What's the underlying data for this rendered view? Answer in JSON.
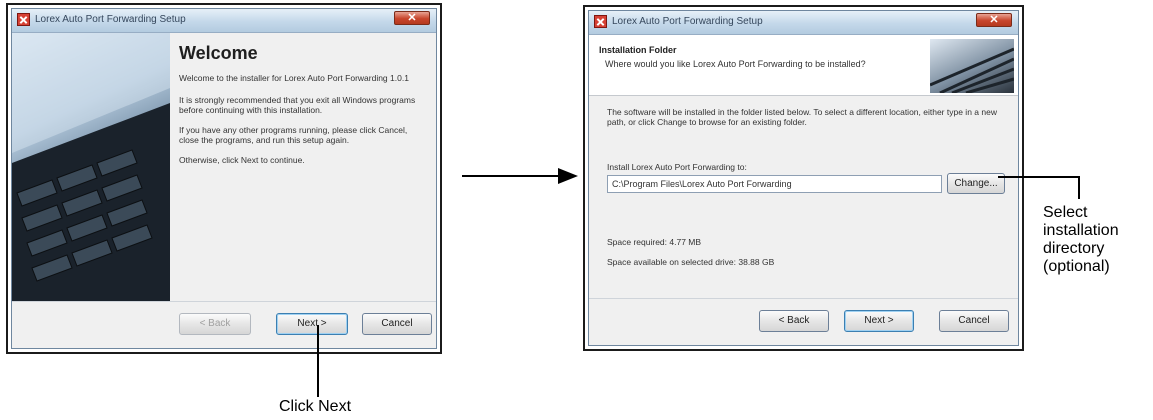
{
  "left_dialog": {
    "title": "Lorex Auto Port Forwarding Setup",
    "close_label": "✕",
    "heading": "Welcome",
    "para1": "Welcome to the installer for Lorex Auto Port Forwarding 1.0.1",
    "para2": "It is strongly recommended that you exit all Windows programs before continuing with this installation.",
    "para3": "If you have any other programs running, please click Cancel, close the programs, and run this setup again.",
    "para4": "Otherwise, click Next to continue.",
    "buttons": {
      "back": "< Back",
      "next": "Next >",
      "cancel": "Cancel"
    }
  },
  "right_dialog": {
    "title": "Lorex Auto Port Forwarding Setup",
    "close_label": "✕",
    "header_title": "Installation Folder",
    "header_subtitle": "Where would you like Lorex Auto Port Forwarding to be installed?",
    "description": "The software will be installed in the folder listed below. To select a different location, either type in a new path, or click Change to browse for an existing folder.",
    "install_label": "Install Lorex Auto Port Forwarding to:",
    "install_path": "C:\\Program Files\\Lorex Auto Port Forwarding",
    "change_button": "Change...",
    "space_required": "Space required: 4.77 MB",
    "space_available": "Space available on selected drive: 38.88 GB",
    "buttons": {
      "back": "< Back",
      "next": "Next >",
      "cancel": "Cancel"
    }
  },
  "callouts": {
    "click_next": "Click Next",
    "select_dir_lines": [
      "Select",
      "installation",
      "directory",
      "(optional)"
    ]
  }
}
